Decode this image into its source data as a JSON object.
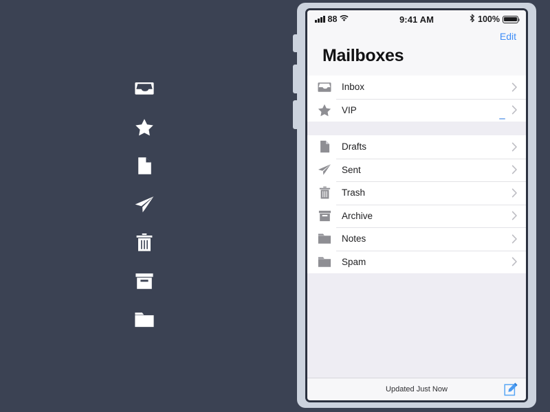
{
  "app": {
    "background_color": "#3b4253",
    "accent_color": "#3c8cf7"
  },
  "icon_strip": {
    "items": [
      {
        "name": "inbox-icon",
        "label": "Inbox"
      },
      {
        "name": "star-icon",
        "label": "VIP"
      },
      {
        "name": "document-icon",
        "label": "Drafts"
      },
      {
        "name": "send-icon",
        "label": "Sent"
      },
      {
        "name": "trash-icon",
        "label": "Trash"
      },
      {
        "name": "archive-icon",
        "label": "Archive"
      },
      {
        "name": "folder-icon",
        "label": "Notes"
      }
    ]
  },
  "phone": {
    "status_bar": {
      "carrier": "88",
      "time": "9:41 AM",
      "battery_percent": "100%",
      "signal_icon": "signal-bars-icon",
      "wifi_icon": "wifi-icon",
      "bluetooth_icon": "bluetooth-icon",
      "battery_icon": "battery-full-icon"
    },
    "nav": {
      "edit_label": "Edit",
      "title": "Mailboxes"
    },
    "groups": [
      {
        "rows": [
          {
            "label": "Inbox",
            "icon": "inbox-icon",
            "accessory": "chevron-right-icon"
          },
          {
            "label": "VIP",
            "icon": "star-icon",
            "accessory": "chevron-right-icon"
          }
        ]
      },
      {
        "rows": [
          {
            "label": "Drafts",
            "icon": "document-icon",
            "accessory": "chevron-right-icon"
          },
          {
            "label": "Sent",
            "icon": "send-icon",
            "accessory": "chevron-right-icon"
          },
          {
            "label": "Trash",
            "icon": "trash-icon",
            "accessory": "chevron-right-icon"
          },
          {
            "label": "Archive",
            "icon": "archive-icon",
            "accessory": "chevron-right-icon"
          },
          {
            "label": "Notes",
            "icon": "folder-icon",
            "accessory": "chevron-right-icon"
          },
          {
            "label": "Spam",
            "icon": "folder-icon",
            "accessory": "chevron-right-icon"
          }
        ]
      }
    ],
    "toolbar": {
      "status_text": "Updated Just Now",
      "compose_icon": "compose-icon"
    }
  }
}
